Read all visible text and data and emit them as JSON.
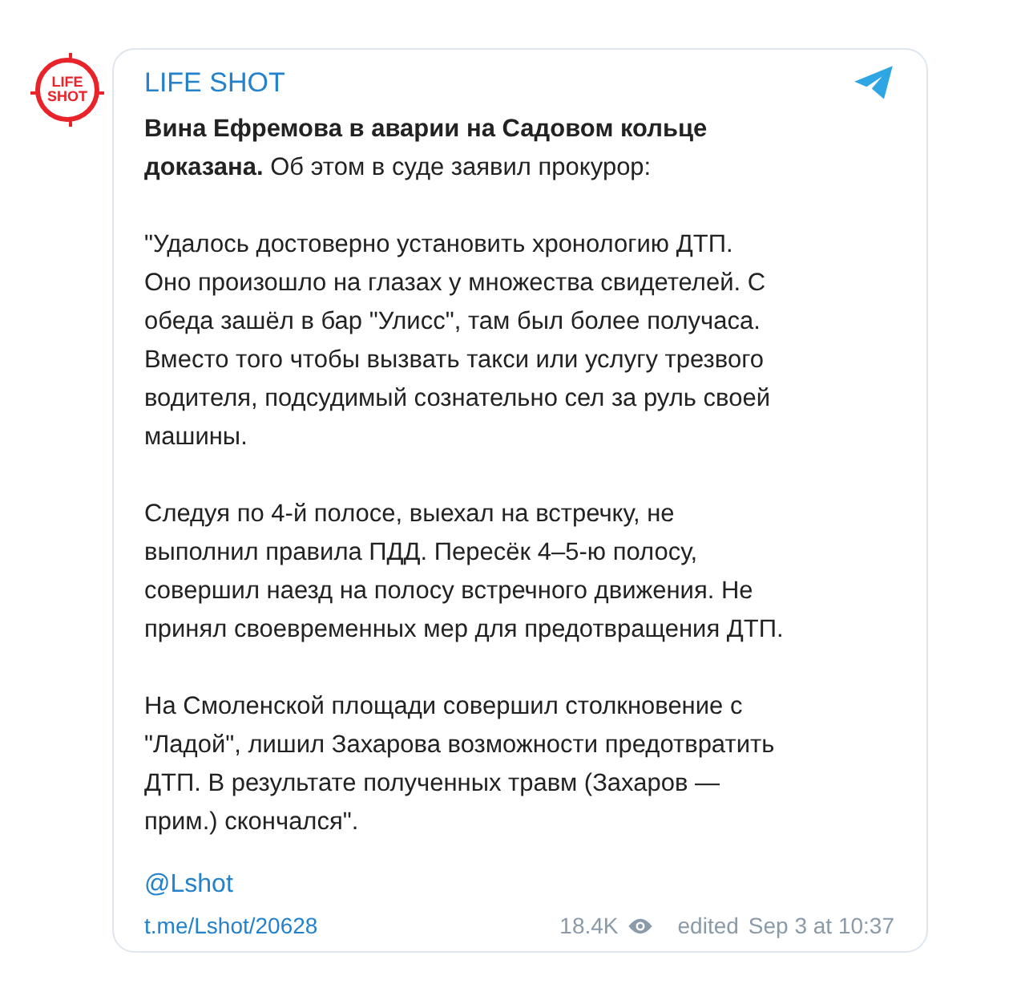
{
  "avatar": {
    "lines": [
      "LIFE",
      "SHOT"
    ]
  },
  "channel": {
    "name": "LIFE SHOT"
  },
  "post": {
    "paragraphs": [
      {
        "lines": [
          "**Вина Ефремова в аварии на Садовом кольце**",
          "**доказана.** Об этом в суде заявил прокурор:"
        ]
      },
      {
        "lines": [
          "\"Удалось достоверно установить хронологию ДТП.",
          "Оно произошло на глазах у множества свидетелей. С",
          "обеда зашёл в бар \"Улисс\", там был более получаса.",
          "Вместо того чтобы вызвать такси или услугу трезвого",
          "водителя, подсудимый сознательно сел за руль своей",
          "машины."
        ]
      },
      {
        "lines": [
          "Следуя по 4-й полосе, выехал на встречку, не",
          "выполнил правила ПДД. Пересёк 4–5-ю полосу,",
          "совершил наезд на полосу встречного движения. Не",
          "принял своевременных мер для предотвращения ДТП."
        ]
      },
      {
        "lines": [
          "На Смоленской площади совершил столкновение с",
          "\"Ладой\", лишил Захарова возможности предотвратить",
          "ДТП. В результате полученных травм (Захаров —",
          "прим.) скончался\"."
        ]
      }
    ],
    "signature": "@Lshot"
  },
  "footer": {
    "link": "t.me/Lshot/20628",
    "views": "18.4K",
    "edited": "edited",
    "date": "Sep 3 at 10:37"
  }
}
